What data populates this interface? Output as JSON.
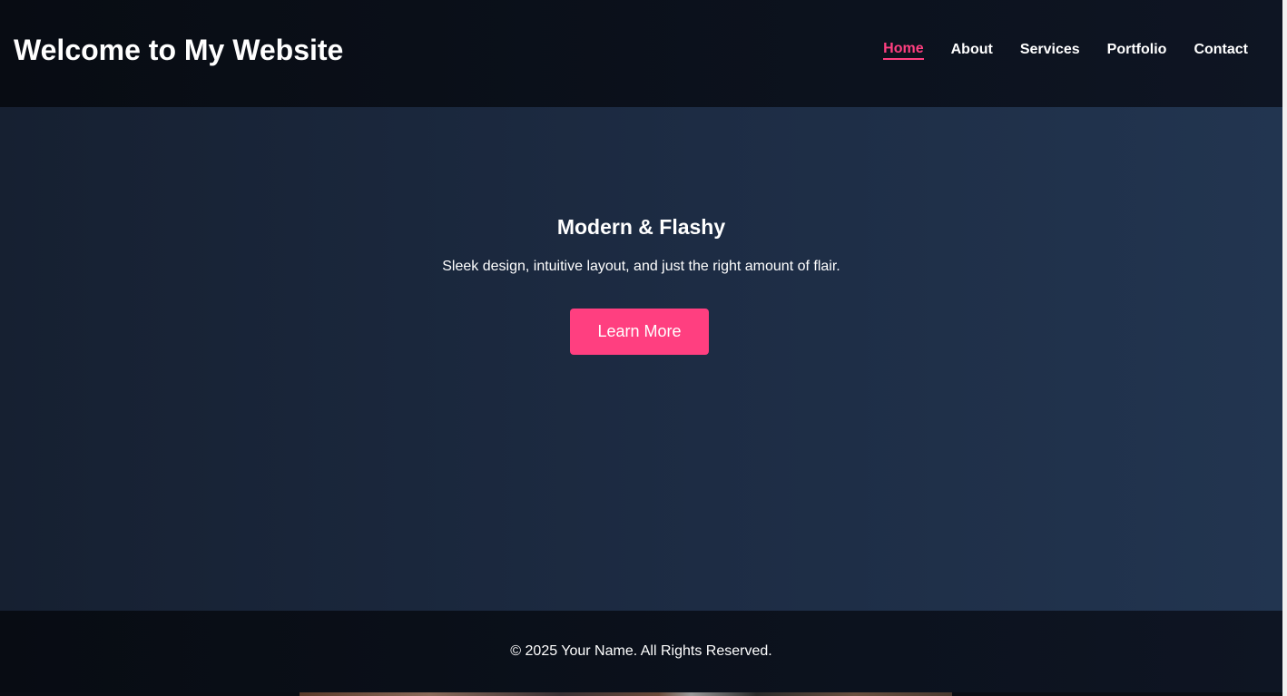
{
  "header": {
    "title": "Welcome to My Website",
    "nav": [
      {
        "label": "Home",
        "active": true
      },
      {
        "label": "About",
        "active": false
      },
      {
        "label": "Services",
        "active": false
      },
      {
        "label": "Portfolio",
        "active": false
      },
      {
        "label": "Contact",
        "active": false
      }
    ]
  },
  "hero": {
    "title": "Modern & Flashy",
    "subtitle": "Sleek design, intuitive layout, and just the right amount of flair.",
    "button_label": "Learn More"
  },
  "footer": {
    "text": "© 2025 Your Name. All Rights Reserved."
  },
  "colors": {
    "accent": "#ff3f80",
    "header_bg": "#0b0f17",
    "hero_bg": "#1d2c44"
  }
}
